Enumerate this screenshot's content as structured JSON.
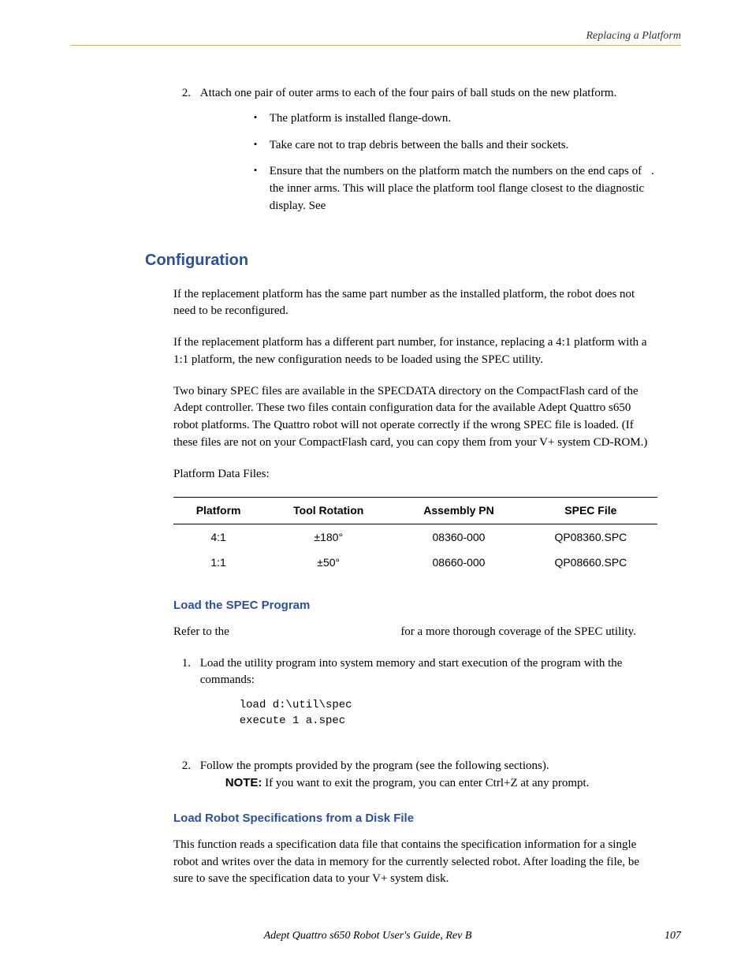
{
  "header": {
    "title": "Replacing a Platform"
  },
  "steps1": {
    "num": "2.",
    "text": "Attach one pair of outer arms to each of the four pairs of ball studs on the new platform.",
    "bullets": [
      "The platform is installed flange-down.",
      "Take care not to trap debris between the balls and their sockets.",
      "Ensure that the numbers on the platform match the numbers on the end caps of the inner arms. This will place the platform tool flange closest to the diagnostic display. See "
    ],
    "b3_after": "."
  },
  "h2_config": "Configuration",
  "para1": "If the replacement platform has the same part number as the installed platform, the robot does not need to be reconfigured.",
  "para2": "If the replacement platform has a different part number, for instance, replacing a 4:1 platform with a 1:1 platform, the new configuration needs to be loaded using the SPEC utility.",
  "para3": "Two binary SPEC files are available in the SPECDATA directory on the CompactFlash card of the Adept controller. These two files contain configuration data for the available Adept Quattro s650 robot platforms. The Quattro robot will not operate correctly if the wrong SPEC file is loaded. (If these files are not on your CompactFlash card, you can copy them from your V+ system CD-ROM.)",
  "para4": "Platform Data Files:",
  "table": {
    "headers": [
      "Platform",
      "Tool Rotation",
      "Assembly PN",
      "SPEC File"
    ],
    "rows": [
      [
        "4:1",
        "±180°",
        "08360-000",
        "QP08360.SPC"
      ],
      [
        "1:1",
        "±50°",
        "08660-000",
        "QP08660.SPC"
      ]
    ]
  },
  "h3_spec": "Load the SPEC Program",
  "spec_para_pre": "Refer to the ",
  "spec_para_post": " for a more thorough coverage of the SPEC utility.",
  "ol2": {
    "num1": "1.",
    "text1": "Load the utility program into system memory and start execution of the program with the commands:",
    "code": "load d:\\util\\spec\nexecute 1 a.spec",
    "num2": "2.",
    "text2": "Follow the prompts provided by the program (see the following sections).",
    "note": "If you want to exit the program, you can enter Ctrl+Z at any prompt.",
    "note_label": "NOTE:"
  },
  "h3_robot": "Load Robot Specifications from a Disk File",
  "para_robot": "This function reads a specification data file that contains the specification information for a single robot and writes over the data in memory for the currently selected robot. After loading the file, be sure to save the specification data to your V+ system disk.",
  "footer": {
    "title": "Adept Quattro s650 Robot User's Guide, Rev B",
    "page": "107"
  }
}
